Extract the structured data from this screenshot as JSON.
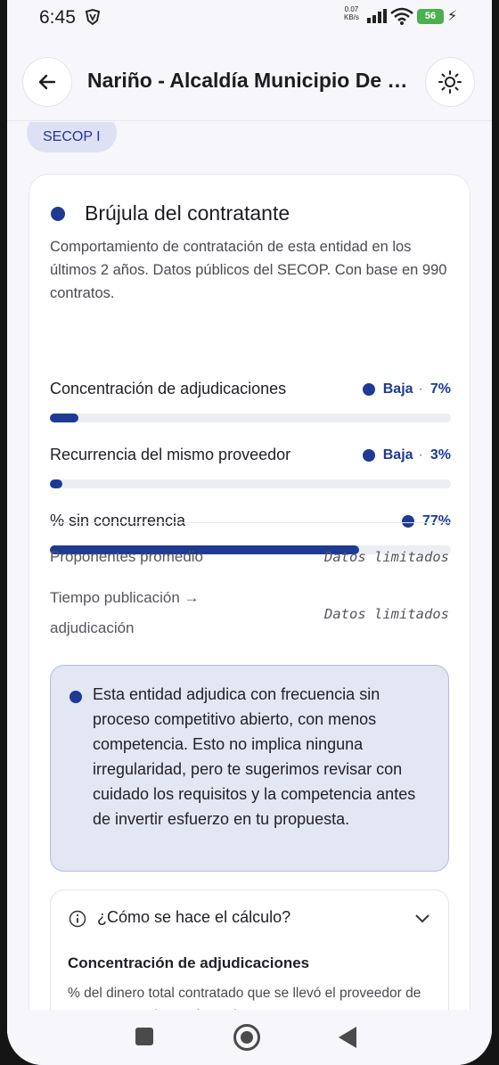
{
  "status_bar": {
    "time": "6:45",
    "net_rate_value": "0.07",
    "net_rate_unit": "KB/s",
    "battery": "56"
  },
  "app_bar": {
    "title": "Nariño - Alcaldía Municipio De Sa...",
    "back_icon": "arrow-left-icon",
    "theme_icon": "sun-icon"
  },
  "chip": {
    "label": "SECOP I"
  },
  "card": {
    "title": "Brújula del contratante",
    "description": "Comportamiento de contratación de esta entidad en los últimos 2 años. Datos públicos del SECOP. Con base en 990 contratos.",
    "metrics": [
      {
        "name": "Concentración de adjudicaciones",
        "level": "Baja",
        "sep": "·",
        "value": "7%",
        "fraction": 0.07
      },
      {
        "name": "Recurrencia del mismo proveedor",
        "level": "Baja",
        "sep": "·",
        "value": "3%",
        "fraction": 0.03
      },
      {
        "name": "% sin concurrencia",
        "level": "",
        "sep": "",
        "value": "77%",
        "fraction": 0.77
      }
    ],
    "rows": [
      {
        "label": "Proponentes promedio",
        "value": "Datos limitados"
      },
      {
        "label_line1": "Tiempo publicación →",
        "label_line2": "adjudicación",
        "value": "Datos limitados"
      }
    ],
    "notice": "Esta entidad adjudica con frecuencia sin proceso competitivo abierto, con menos competencia. Esto no implica ninguna irregularidad, pero te sugerimos revisar con cuidado los requisitos y la competencia antes de invertir esfuerzo en tu propuesta.",
    "calc": {
      "question": "¿Cómo se hace el cálculo?",
      "subtitle": "Concentración de adjudicaciones",
      "subtitle_desc": "% del dinero total contratado que se llevó el proveedor de mayor monto (se excluyen los"
    }
  },
  "colors": {
    "accent": "#1e3a94",
    "chip_bg": "#dde1f3",
    "notice_bg": "#e3e6f3"
  }
}
